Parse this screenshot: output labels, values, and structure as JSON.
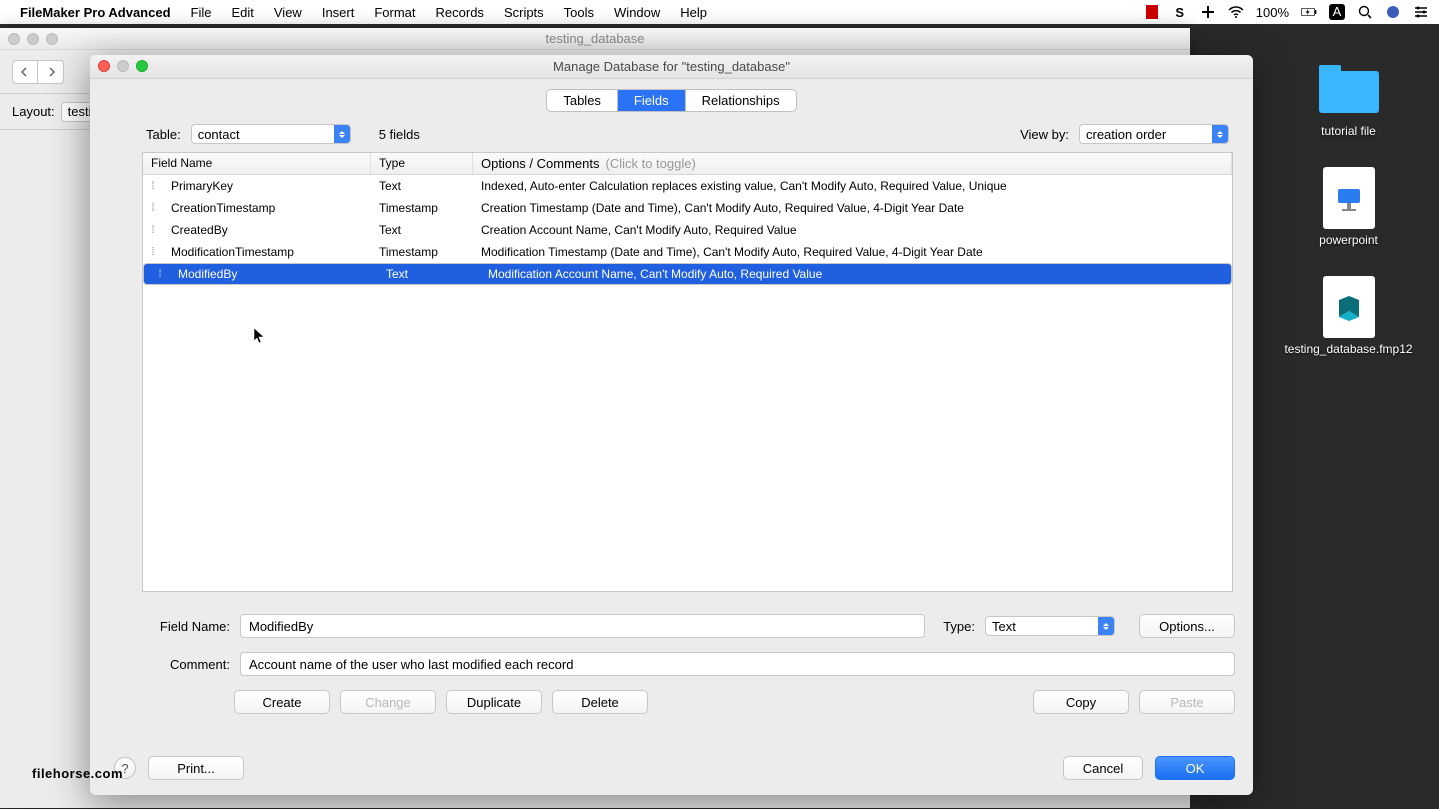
{
  "menubar": {
    "app_name": "FileMaker Pro Advanced",
    "items": [
      "File",
      "Edit",
      "View",
      "Insert",
      "Format",
      "Records",
      "Scripts",
      "Tools",
      "Window",
      "Help"
    ],
    "battery": "100%"
  },
  "bg_window": {
    "title": "testing_database",
    "layout_label": "Layout:",
    "layout_value": "testi"
  },
  "dialog": {
    "title": "Manage Database for \"testing_database\"",
    "tabs": {
      "tables": "Tables",
      "fields": "Fields",
      "relationships": "Relationships"
    },
    "table_label": "Table:",
    "table_value": "contact",
    "field_count": "5 fields",
    "view_by_label": "View by:",
    "view_by_value": "creation order",
    "columns": {
      "name": "Field Name",
      "type": "Type",
      "options": "Options / Comments",
      "hint": "(Click to toggle)"
    },
    "rows": [
      {
        "name": "PrimaryKey",
        "type": "Text",
        "opts": "Indexed, Auto-enter Calculation replaces existing value, Can't Modify Auto, Required Value, Unique",
        "sel": false
      },
      {
        "name": "CreationTimestamp",
        "type": "Timestamp",
        "opts": "Creation Timestamp (Date and Time), Can't Modify Auto, Required Value, 4-Digit Year Date",
        "sel": false
      },
      {
        "name": "CreatedBy",
        "type": "Text",
        "opts": "Creation Account Name, Can't Modify Auto, Required Value",
        "sel": false
      },
      {
        "name": "ModificationTimestamp",
        "type": "Timestamp",
        "opts": "Modification Timestamp (Date and Time), Can't Modify Auto, Required Value, 4-Digit Year Date",
        "sel": false
      },
      {
        "name": "ModifiedBy",
        "type": "Text",
        "opts": "Modification Account Name, Can't Modify Auto, Required Value",
        "sel": true
      }
    ],
    "field_name_label": "Field Name:",
    "field_name_value": "ModifiedBy",
    "type_label": "Type:",
    "type_value": "Text",
    "options_btn": "Options...",
    "comment_label": "Comment:",
    "comment_value": "Account name of the user who last modified each record",
    "buttons": {
      "create": "Create",
      "change": "Change",
      "duplicate": "Duplicate",
      "delete": "Delete",
      "copy": "Copy",
      "paste": "Paste"
    },
    "print_btn": "Print...",
    "cancel_btn": "Cancel",
    "ok_btn": "OK"
  },
  "desktop": {
    "items": [
      {
        "label": "tutorial file",
        "kind": "folder"
      },
      {
        "label": "powerpoint",
        "kind": "keynote"
      },
      {
        "label": "testing_database.fmp12",
        "kind": "fm"
      }
    ]
  },
  "watermark": "filehorse.com"
}
